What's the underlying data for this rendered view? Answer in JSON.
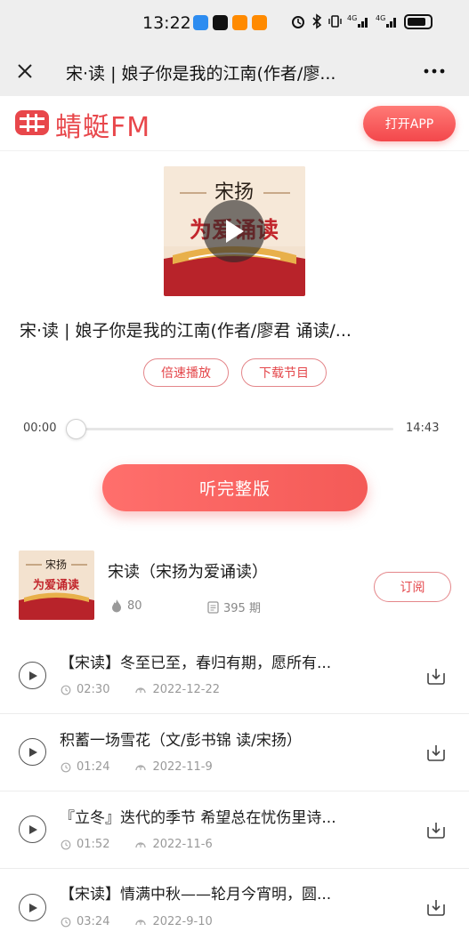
{
  "status_bar": {
    "time": "13:22",
    "right_text": "4G 4G",
    "app_icon_colors": [
      "#2d8cf0",
      "#111111",
      "#ff8a00",
      "#ff8a00"
    ]
  },
  "browser": {
    "title": "宋·读 | 娘子你是我的江南(作者/廖...",
    "close_icon": "close-icon",
    "more_icon": "more-icon"
  },
  "header": {
    "logo_text": "蜻蜓FM",
    "open_app_label": "打开APP",
    "brand_color": "#e8474b"
  },
  "cover": {
    "line1": "宋扬",
    "line2": "为爱诵读"
  },
  "program": {
    "title": "宋·读 | 娘子你是我的江南(作者/廖君 诵读/..."
  },
  "actions": {
    "speed_label": "倍速播放",
    "download_label": "下载节目"
  },
  "player": {
    "current_time": "00:00",
    "total_time": "14:43",
    "progress": 0,
    "listen_full_label": "听完整版"
  },
  "album": {
    "name": "宋读（宋扬为爱诵读）",
    "hot": "80",
    "episodes": "395 期",
    "subscribe_label": "订阅"
  },
  "episodes": [
    {
      "title": "【宋读】冬至已至，春归有期，愿所有...",
      "duration": "02:30",
      "date": "2022-12-22"
    },
    {
      "title": "积蓄一场雪花（文/彭书锦 读/宋扬）",
      "duration": "01:24",
      "date": "2022-11-9"
    },
    {
      "title": "『立冬』迭代的季节 希望总在忧伤里诗...",
      "duration": "01:52",
      "date": "2022-11-6"
    },
    {
      "title": "【宋读】情满中秋——轮月今宵明，圆...",
      "duration": "03:24",
      "date": "2022-9-10"
    }
  ]
}
